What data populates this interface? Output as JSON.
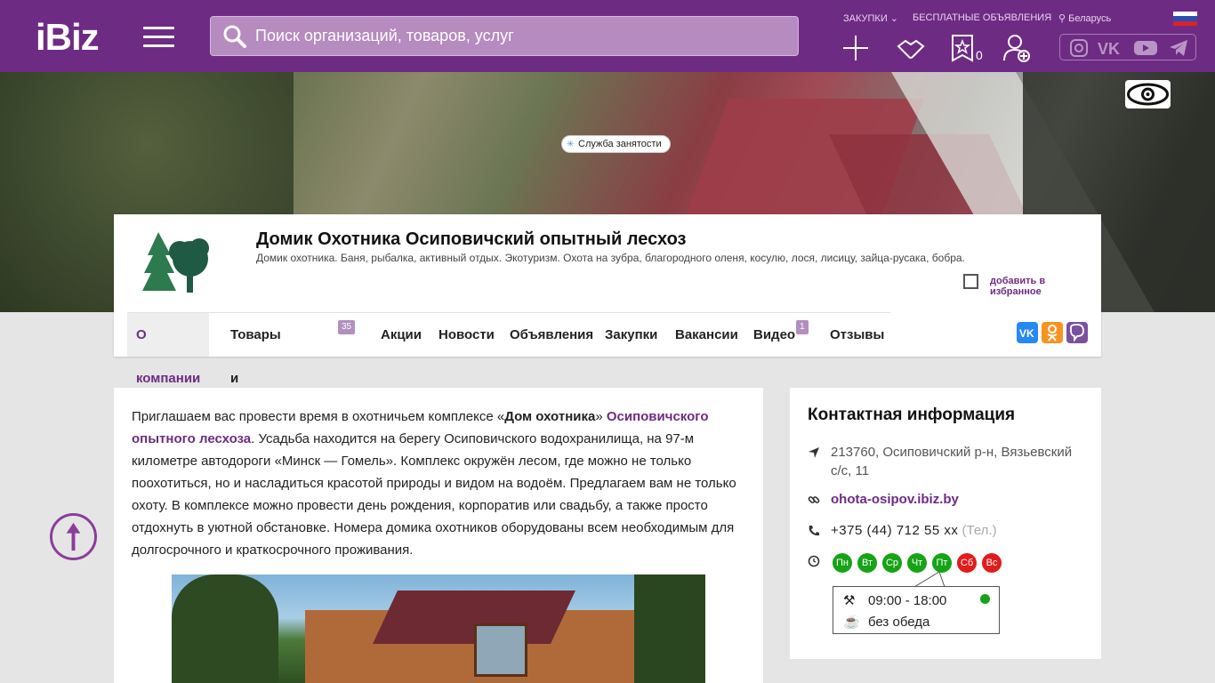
{
  "header": {
    "logo": "iBiz",
    "search_placeholder": "Поиск организаций, товаров, услуг",
    "purchases_label": "ЗАКУПКИ",
    "free_ads_label": "БЕСПЛАТНЫЕ ОБЪЯВЛЕНИЯ",
    "region_label": "Беларусь",
    "favorites_count": "0",
    "brand_color": "#6e2b84"
  },
  "company": {
    "title": "Домик Охотника Осиповичский опытный лесхоз",
    "description": "Домик охотника. Баня, рыбалка, активный отдых. Экотуризм. Охота на зубра, благородного оленя, косулю, лося, лисицу, зайца-русака, бобра.",
    "add_favorite_label": "добавить в избранное"
  },
  "tabs": [
    {
      "label": "О компании",
      "badge": ""
    },
    {
      "label": "Товары и услуги",
      "badge": "35"
    },
    {
      "label": "Акции",
      "badge": ""
    },
    {
      "label": "Новости",
      "badge": ""
    },
    {
      "label": "Объявления",
      "badge": ""
    },
    {
      "label": "Закупки",
      "badge": ""
    },
    {
      "label": "Вакансии",
      "badge": ""
    },
    {
      "label": "Видео",
      "badge": "1"
    },
    {
      "label": "Отзывы",
      "badge": ""
    }
  ],
  "vacancy_tip": "Служба занятости",
  "about": {
    "p1": "Приглашаем вас провести время в охотничьем комплексе «",
    "p1_bold": "Дом охотника",
    "p1_after": "» ",
    "p1_link": "Осиповичского опытного лесхоза",
    "p1_rest": ". Усадьба находится на берегу Осиповичского водохранилища, на 97-м километре автодороги «Минск — Гомель». Комплекс окружён лесом, где можно не только поохотиться, но и насладиться красотой природы и видом на водоём. Предлагаем вам не только охоту. В комплексе можно провести день рождения, корпоратив или свадьбу, а также просто отдохнуть в уютной обстановке. Номера домика охотников оборудованы всем необходимым для долгосрочного и краткосрочного проживания."
  },
  "contact": {
    "heading": "Контактная информация",
    "address_line1": "213760, Осиповичский р-н, Вязьевский",
    "address_line2": "с/с, 11",
    "website": "ohota-osipov.ibiz.by",
    "phone": "+375 (44) 712 55 xx",
    "phone_note": "(Тел.)",
    "days": [
      {
        "label": "Пн",
        "status": "open"
      },
      {
        "label": "Вт",
        "status": "open"
      },
      {
        "label": "Ср",
        "status": "open"
      },
      {
        "label": "Чт",
        "status": "open"
      },
      {
        "label": "Пт",
        "status": "open"
      },
      {
        "label": "Сб",
        "status": "closed"
      },
      {
        "label": "Вс",
        "status": "closed"
      }
    ],
    "hours": "09:00 - 18:00",
    "lunch": "без обеда"
  }
}
